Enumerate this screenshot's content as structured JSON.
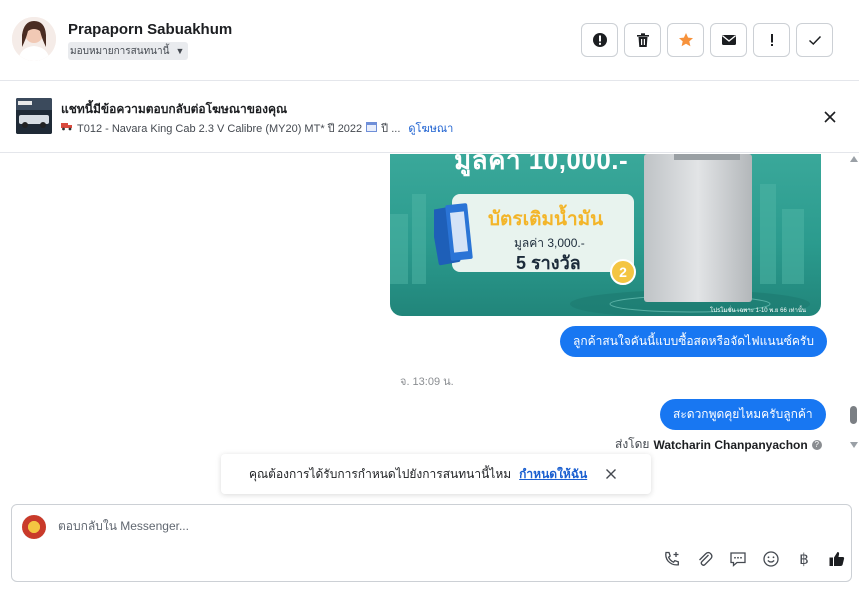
{
  "header": {
    "user_name": "Prapaporn Sabuakhum",
    "assign_label": "มอบหมายการสนทนานี้",
    "actions": [
      {
        "name": "mark-spam-button",
        "icon": "alert-circle-icon"
      },
      {
        "name": "delete-button",
        "icon": "trash-icon"
      },
      {
        "name": "star-button",
        "icon": "star-icon"
      },
      {
        "name": "mark-unread-button",
        "icon": "envelope-icon"
      },
      {
        "name": "follow-up-button",
        "icon": "exclamation-icon"
      },
      {
        "name": "mark-done-button",
        "icon": "check-icon"
      }
    ]
  },
  "ad_bar": {
    "title": "แชทนี้มีข้อความตอบกลับต่อโฆษณาของคุณ",
    "subtitle": "T012 - Navara King Cab 2.3 V Calibre (MY20) MT* ปี 2022",
    "subtitle_more": "ปี ...",
    "link": "ดูโฆษณา"
  },
  "messages": {
    "promo": {
      "headline": "มูลค่า 10,000.-",
      "card_title": "บัตรเติมน้ำมัน",
      "card_value": "มูลค่า 3,000.-",
      "card_prize": "5 รางวัล",
      "badge": "2",
      "footnote": "โปรโมชั่น เฉพาะ 1-10 พ.ย 66 เท่านั้น"
    },
    "bubble_1": "ลูกค้าสนใจคันนี้แบบซื้อสดหรือจัดไฟแนนซ์ครับ",
    "timestamp": "จ. 13:09 น.",
    "bubble_2": "สะดวกพูดคุยไหมครับลูกค้า",
    "sent_by_label": "ส่งโดย",
    "sent_by_name": "Watcharin Chanpanyachon"
  },
  "toast": {
    "text": "คุณต้องการได้รับการกำหนดไปยังการสนทนานี้ไหม",
    "link": "กำหนดให้ฉัน"
  },
  "composer": {
    "placeholder": "ตอบกลับใน Messenger...",
    "baht_symbol": "฿"
  },
  "colors": {
    "accent": "#1877f2",
    "star": "#f7923b",
    "link": "#1a5fd0"
  }
}
